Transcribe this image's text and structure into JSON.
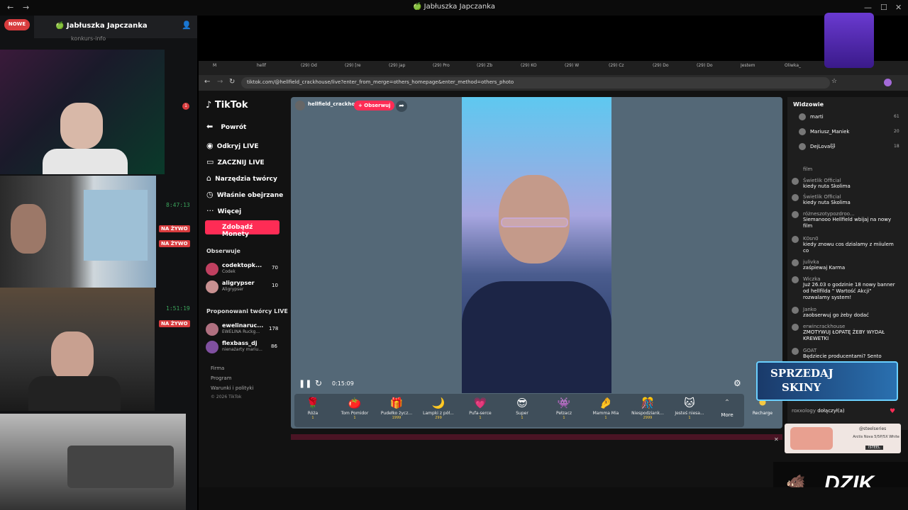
{
  "window": {
    "title": "🍏 Jabłuszka Japczanka"
  },
  "discord": {
    "new_badge": "NOWE",
    "server_name": "🍏 Jabłuszka Japczanka",
    "channel": "konkurs-info",
    "notif_count": "1",
    "timer1": "8:47:13",
    "timer2": "1:51:19",
    "live1": "NA ŻYWO",
    "live2": "NA ŻYWO",
    "live3": "NA ŻYWO"
  },
  "browser": {
    "tabs": [
      "M",
      "hellf",
      "(29) Od",
      "(29) [re",
      "(29) jap",
      "(29) Pro",
      "(29) Zb",
      "(29) KO",
      "(29) W",
      "(29) Cz",
      "(29) Do",
      "(29) Do",
      "Jestem",
      "Oliwka_"
    ],
    "url": "tiktok.com/@hellfield_crackhouse/live?enter_from_merge=others_homepage&enter_method=others_photo"
  },
  "tiktok": {
    "logo": "TikTok",
    "back": "Powrót",
    "nav": [
      "Odkryj LIVE",
      "ZACZNIJ LIVE",
      "Narzędzia twórcy",
      "Właśnie obejrzane",
      "Więcej"
    ],
    "coins_button": "Zdobądź Monety",
    "following_title": "Obserwuje",
    "following": [
      {
        "name": "codektopk...",
        "sub": "Codek",
        "count": "70"
      },
      {
        "name": "aligrypser",
        "sub": "Aligrypser",
        "count": "10"
      }
    ],
    "suggested_title": "Proponowani twórcy LIVE",
    "suggested": [
      {
        "name": "ewelinaruc...",
        "sub": "EWELINA Ruckg...",
        "count": "178"
      },
      {
        "name": "flexbass_dj",
        "sub": "nienażarty mariu...",
        "count": "86"
      }
    ],
    "footer": [
      "Firma",
      "Program",
      "Warunki i polityki",
      "© 2026 TikTok"
    ]
  },
  "stream": {
    "host": "hellfield_crackhouse",
    "follow": "+ Obserwuj",
    "time": "0:15:09"
  },
  "gifts": [
    {
      "icon": "🌹",
      "name": "Róża",
      "price": "1"
    },
    {
      "icon": "🍅",
      "name": "Tom Pomidor",
      "price": "1"
    },
    {
      "icon": "🎁",
      "name": "Pudełko życz...",
      "price": "1999"
    },
    {
      "icon": "🌙",
      "name": "Lampki z pół...",
      "price": "299"
    },
    {
      "icon": "💗",
      "name": "Pufa-serce",
      "price": "1"
    },
    {
      "icon": "😎",
      "name": "Super",
      "price": "1"
    },
    {
      "icon": "👾",
      "name": "Pełzacz",
      "price": "1"
    },
    {
      "icon": "🤌",
      "name": "Mamma Mia",
      "price": "1"
    },
    {
      "icon": "🎊",
      "name": "Niespodziank...",
      "price": "2999"
    },
    {
      "icon": "🐱",
      "name": "Jesteś niesa...",
      "price": "1"
    }
  ],
  "gift_more": "More",
  "recharge": "Recharge",
  "viewers": {
    "title": "Widzowie",
    "list": [
      {
        "name": "marti",
        "score": "61"
      },
      {
        "name": "Mariusz_Maniek",
        "score": "20"
      },
      {
        "name": "DejLova🐱",
        "score": "18"
      }
    ]
  },
  "chat": [
    {
      "user": "film",
      "msg": ""
    },
    {
      "user": "Świetlik Official",
      "msg": "kiedy nuta Skolima"
    },
    {
      "user": "Świetlik Official",
      "msg": "kiedy nuta Skolima"
    },
    {
      "user": "różneszotypozdroo...",
      "msg": "Siemanooo Hellfield wbijaj na nowy film"
    },
    {
      "user": "K0sn0",
      "msg": "kiedy znowu cos dzialamy z miiulem co"
    },
    {
      "user": "julivka",
      "msg": "zaśpiewaj Karma"
    },
    {
      "user": "Wiczka",
      "msg": "Już 26.03 o godzinie 18 nowy banner od hellfilda \" Wartość Akcji\" rozwalamy system!"
    },
    {
      "user": "Janko",
      "msg": "zaobserwuj go żeby dodać"
    },
    {
      "user": "erwincrackhouse",
      "msg": "ZMOTYWUJ ŁOPATĘ ŻEBY WYDAŁ KREWETKI"
    },
    {
      "user": "GOAT",
      "msg": "Będziecie producentami? Sento"
    }
  ],
  "join": {
    "user": "roxxology",
    "text": "dołączył(a)"
  },
  "overlay": {
    "sell_line1": "SPRZEDAJ",
    "sell_line2": "SKINY",
    "ad_brand": "@steelseries",
    "ad_product": "Arctis Nova 5/5P/5X White",
    "ad_shop": "ISTEEL",
    "dzik": "DZIK"
  }
}
